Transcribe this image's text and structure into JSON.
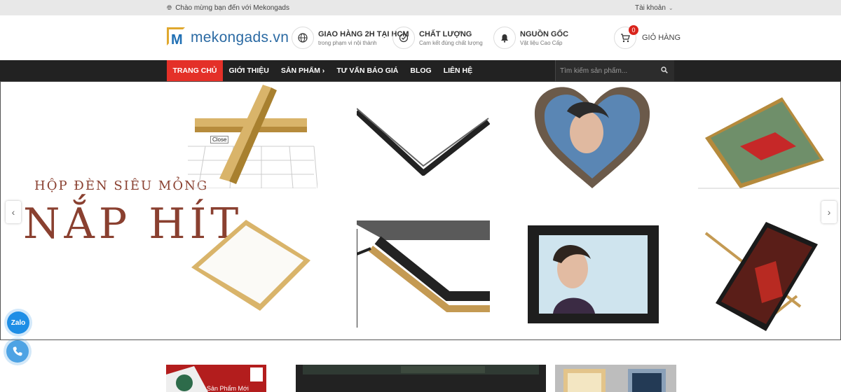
{
  "topbar": {
    "welcome_text": "Chào mừng bạn đến với Mekongads",
    "account_label": "Tài khoản"
  },
  "header": {
    "logo_text": "mekongads.vn",
    "features": [
      {
        "title": "GIAO HÀNG 2H TẠI HCM",
        "subtitle": "trong phạm vi nội thành",
        "icon": "globe-icon"
      },
      {
        "title": "CHẤT LƯỢNG",
        "subtitle": "Cam kết đúng chất lượng",
        "icon": "check-circle-icon"
      },
      {
        "title": "NGUỒN GỐC",
        "subtitle": "Vật liệu Cao Cấp",
        "icon": "bell-icon"
      }
    ],
    "cart": {
      "label": "GIỎ HÀNG",
      "count": "0"
    }
  },
  "nav": {
    "items": [
      {
        "label": "TRANG CHỦ",
        "active": true
      },
      {
        "label": "GIỚI THIỆU",
        "active": false
      },
      {
        "label": "SẢN PHẨM ›",
        "active": false
      },
      {
        "label": "TƯ VẤN BÁO GIÁ",
        "active": false
      },
      {
        "label": "BLOG",
        "active": false
      },
      {
        "label": "LIÊN HỆ",
        "active": false
      }
    ],
    "search_placeholder": "Tìm kiếm sản phẩm..."
  },
  "slider": {
    "title": "HỘP ĐÈN SIÊU MỎNG",
    "headline": "NẮP HÍT",
    "close_tooltip": "Close",
    "prev_arrow": "‹",
    "next_arrow": "›"
  },
  "floating": {
    "zalo_label": "Zalo"
  },
  "banners": {
    "new_products_label": "Sản Phẩm Mới"
  },
  "colors": {
    "accent_red": "#e43028",
    "nav_bg": "#222222",
    "brand_blue": "#2b6aa3",
    "brand_gold": "#e0a82e",
    "headline_brown": "#8a4030"
  }
}
